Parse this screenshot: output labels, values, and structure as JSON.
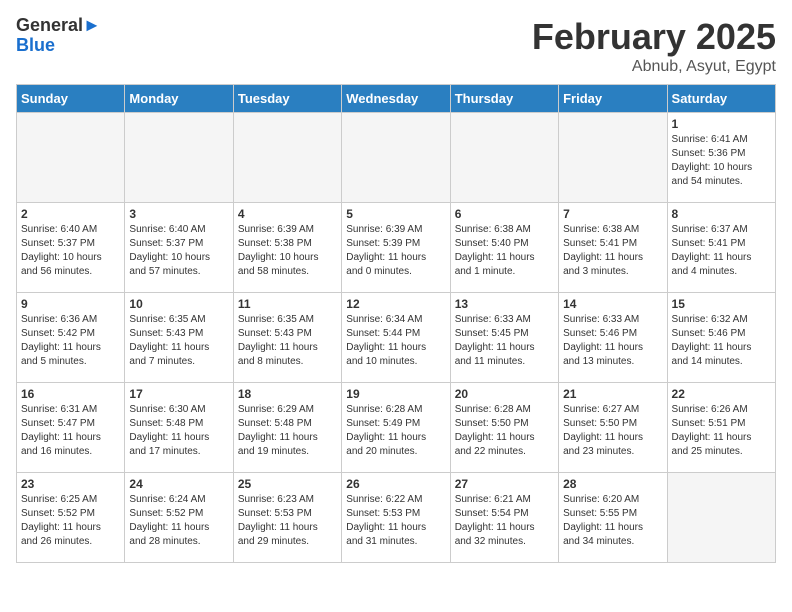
{
  "header": {
    "logo_general": "General",
    "logo_blue": "Blue",
    "title": "February 2025",
    "subtitle": "Abnub, Asyut, Egypt"
  },
  "days_of_week": [
    "Sunday",
    "Monday",
    "Tuesday",
    "Wednesday",
    "Thursday",
    "Friday",
    "Saturday"
  ],
  "weeks": [
    [
      {
        "day": "",
        "info": ""
      },
      {
        "day": "",
        "info": ""
      },
      {
        "day": "",
        "info": ""
      },
      {
        "day": "",
        "info": ""
      },
      {
        "day": "",
        "info": ""
      },
      {
        "day": "",
        "info": ""
      },
      {
        "day": "1",
        "info": "Sunrise: 6:41 AM\nSunset: 5:36 PM\nDaylight: 10 hours\nand 54 minutes."
      }
    ],
    [
      {
        "day": "2",
        "info": "Sunrise: 6:40 AM\nSunset: 5:37 PM\nDaylight: 10 hours\nand 56 minutes."
      },
      {
        "day": "3",
        "info": "Sunrise: 6:40 AM\nSunset: 5:37 PM\nDaylight: 10 hours\nand 57 minutes."
      },
      {
        "day": "4",
        "info": "Sunrise: 6:39 AM\nSunset: 5:38 PM\nDaylight: 10 hours\nand 58 minutes."
      },
      {
        "day": "5",
        "info": "Sunrise: 6:39 AM\nSunset: 5:39 PM\nDaylight: 11 hours\nand 0 minutes."
      },
      {
        "day": "6",
        "info": "Sunrise: 6:38 AM\nSunset: 5:40 PM\nDaylight: 11 hours\nand 1 minute."
      },
      {
        "day": "7",
        "info": "Sunrise: 6:38 AM\nSunset: 5:41 PM\nDaylight: 11 hours\nand 3 minutes."
      },
      {
        "day": "8",
        "info": "Sunrise: 6:37 AM\nSunset: 5:41 PM\nDaylight: 11 hours\nand 4 minutes."
      }
    ],
    [
      {
        "day": "9",
        "info": "Sunrise: 6:36 AM\nSunset: 5:42 PM\nDaylight: 11 hours\nand 5 minutes."
      },
      {
        "day": "10",
        "info": "Sunrise: 6:35 AM\nSunset: 5:43 PM\nDaylight: 11 hours\nand 7 minutes."
      },
      {
        "day": "11",
        "info": "Sunrise: 6:35 AM\nSunset: 5:43 PM\nDaylight: 11 hours\nand 8 minutes."
      },
      {
        "day": "12",
        "info": "Sunrise: 6:34 AM\nSunset: 5:44 PM\nDaylight: 11 hours\nand 10 minutes."
      },
      {
        "day": "13",
        "info": "Sunrise: 6:33 AM\nSunset: 5:45 PM\nDaylight: 11 hours\nand 11 minutes."
      },
      {
        "day": "14",
        "info": "Sunrise: 6:33 AM\nSunset: 5:46 PM\nDaylight: 11 hours\nand 13 minutes."
      },
      {
        "day": "15",
        "info": "Sunrise: 6:32 AM\nSunset: 5:46 PM\nDaylight: 11 hours\nand 14 minutes."
      }
    ],
    [
      {
        "day": "16",
        "info": "Sunrise: 6:31 AM\nSunset: 5:47 PM\nDaylight: 11 hours\nand 16 minutes."
      },
      {
        "day": "17",
        "info": "Sunrise: 6:30 AM\nSunset: 5:48 PM\nDaylight: 11 hours\nand 17 minutes."
      },
      {
        "day": "18",
        "info": "Sunrise: 6:29 AM\nSunset: 5:48 PM\nDaylight: 11 hours\nand 19 minutes."
      },
      {
        "day": "19",
        "info": "Sunrise: 6:28 AM\nSunset: 5:49 PM\nDaylight: 11 hours\nand 20 minutes."
      },
      {
        "day": "20",
        "info": "Sunrise: 6:28 AM\nSunset: 5:50 PM\nDaylight: 11 hours\nand 22 minutes."
      },
      {
        "day": "21",
        "info": "Sunrise: 6:27 AM\nSunset: 5:50 PM\nDaylight: 11 hours\nand 23 minutes."
      },
      {
        "day": "22",
        "info": "Sunrise: 6:26 AM\nSunset: 5:51 PM\nDaylight: 11 hours\nand 25 minutes."
      }
    ],
    [
      {
        "day": "23",
        "info": "Sunrise: 6:25 AM\nSunset: 5:52 PM\nDaylight: 11 hours\nand 26 minutes."
      },
      {
        "day": "24",
        "info": "Sunrise: 6:24 AM\nSunset: 5:52 PM\nDaylight: 11 hours\nand 28 minutes."
      },
      {
        "day": "25",
        "info": "Sunrise: 6:23 AM\nSunset: 5:53 PM\nDaylight: 11 hours\nand 29 minutes."
      },
      {
        "day": "26",
        "info": "Sunrise: 6:22 AM\nSunset: 5:53 PM\nDaylight: 11 hours\nand 31 minutes."
      },
      {
        "day": "27",
        "info": "Sunrise: 6:21 AM\nSunset: 5:54 PM\nDaylight: 11 hours\nand 32 minutes."
      },
      {
        "day": "28",
        "info": "Sunrise: 6:20 AM\nSunset: 5:55 PM\nDaylight: 11 hours\nand 34 minutes."
      },
      {
        "day": "",
        "info": ""
      }
    ]
  ]
}
